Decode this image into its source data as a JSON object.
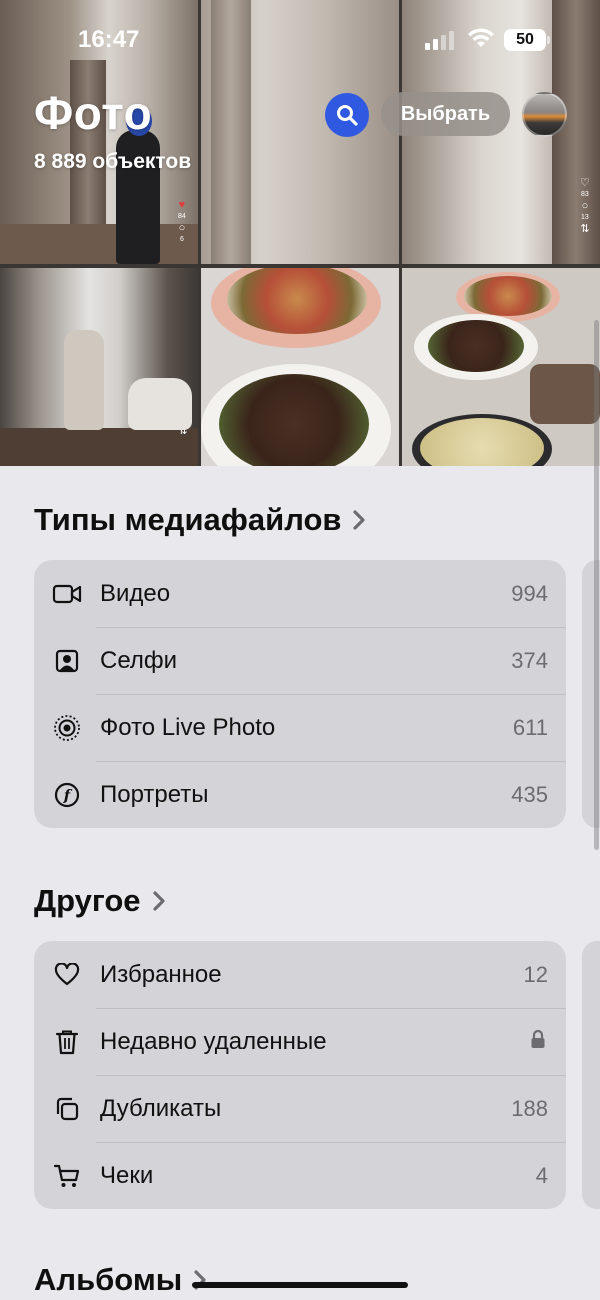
{
  "status_bar": {
    "time": "16:47",
    "battery": "50"
  },
  "header": {
    "title": "Фото",
    "count": "8 889 объектов",
    "search_icon": "magnifier-icon",
    "select_label": "Выбрать",
    "avatar_icon": "avatar"
  },
  "grid": {
    "tile1": {
      "likes": "84",
      "comments": "6"
    },
    "tile3": {
      "likes": "83",
      "comments": "13"
    },
    "tile4": {
      "likes": "35"
    }
  },
  "media_types": {
    "title": "Типы медиафайлов",
    "items": [
      {
        "icon": "video-icon",
        "label": "Видео",
        "count": "994"
      },
      {
        "icon": "selfie-icon",
        "label": "Селфи",
        "count": "374"
      },
      {
        "icon": "live-photo-icon",
        "label": "Фото Live Photo",
        "count": "611"
      },
      {
        "icon": "portrait-icon",
        "label": "Портреты",
        "count": "435"
      }
    ]
  },
  "other": {
    "title": "Другое",
    "items": [
      {
        "icon": "heart-icon",
        "label": "Избранное",
        "count": "12"
      },
      {
        "icon": "trash-icon",
        "label": "Недавно удаленные",
        "count": "",
        "trailing_icon": "lock-icon"
      },
      {
        "icon": "duplicate-icon",
        "label": "Дубликаты",
        "count": "188"
      },
      {
        "icon": "cart-icon",
        "label": "Чеки",
        "count": "4"
      }
    ]
  },
  "albums": {
    "title": "Альбомы"
  }
}
